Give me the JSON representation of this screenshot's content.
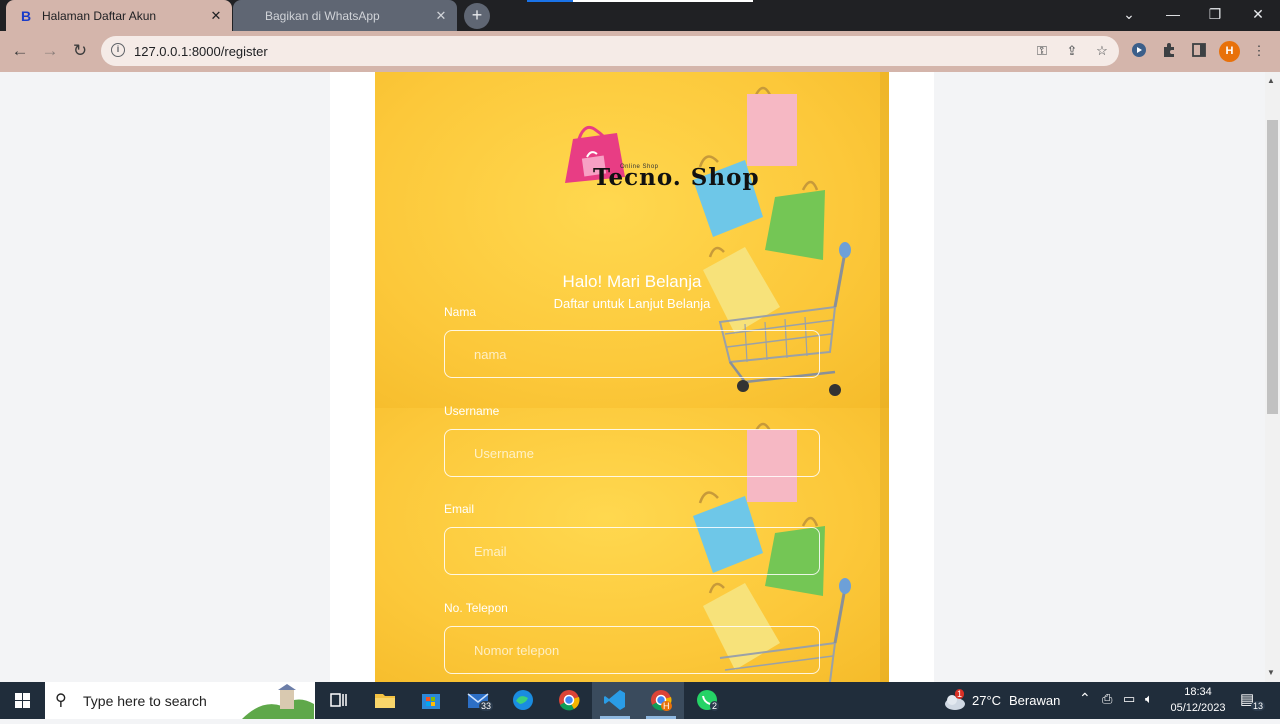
{
  "browser": {
    "tabs": [
      {
        "title": "Halaman Daftar Akun",
        "favicon": "B",
        "active": true
      },
      {
        "title": "Bagikan di WhatsApp",
        "active": false
      }
    ],
    "new_tab_label": "+",
    "address": "127.0.0.1:8000/register",
    "profile_initial": "H"
  },
  "page": {
    "logo": {
      "brand": "Tecno. Shop",
      "tagline": "Online Shop"
    },
    "greeting": "Halo! Mari Belanja",
    "subtitle": "Daftar untuk Lanjut Belanja",
    "fields": [
      {
        "label": "Nama",
        "placeholder": "nama"
      },
      {
        "label": "Username",
        "placeholder": "Username"
      },
      {
        "label": "Email",
        "placeholder": "Email"
      },
      {
        "label": "No. Telepon",
        "placeholder": "Nomor telepon"
      }
    ]
  },
  "taskbar": {
    "search_placeholder": "Type here to search",
    "mail_badge": "33",
    "whatsapp_badge": "2",
    "weather_badge": "1",
    "temperature": "27°C",
    "weather": "Berawan",
    "time": "18:34",
    "date": "05/12/2023",
    "notifications": "13",
    "chrome_profile": "H"
  },
  "colors": {
    "tab_active": "#d4b5ab",
    "card_bg": "#fcc83a",
    "taskbar": "#202d3b",
    "profile": "#e8710a"
  }
}
